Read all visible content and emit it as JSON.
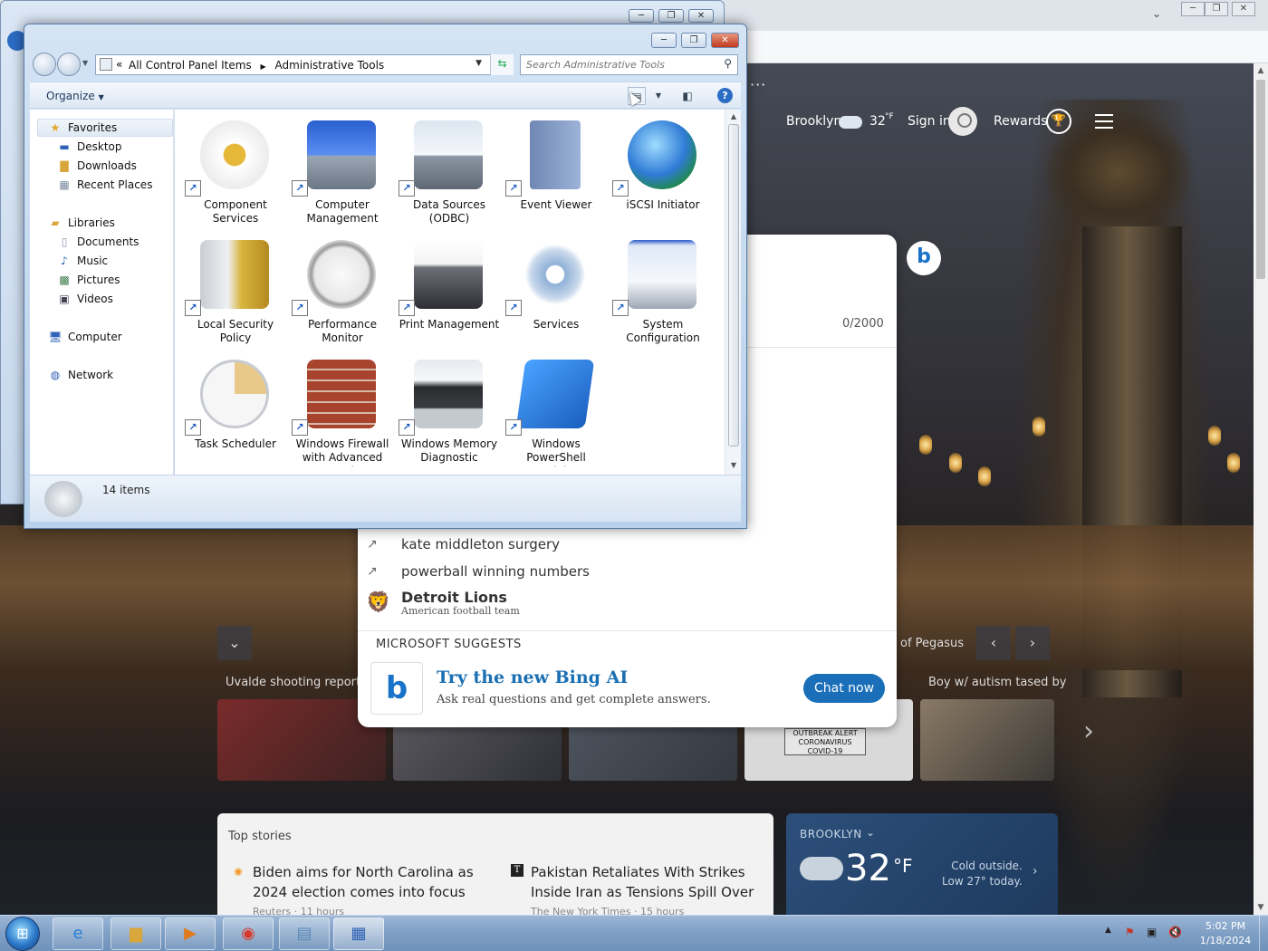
{
  "browser": {
    "window_controls": [
      "─",
      "❐",
      "✕"
    ],
    "toolbar_icons": [
      "share-icon",
      "star-icon",
      "sidebar-icon",
      "profile-icon",
      "menu-icon"
    ]
  },
  "msn": {
    "more_label": "···",
    "location": "Brooklyn",
    "temperature": "32",
    "temp_unit": "°F",
    "sign_in": "Sign in",
    "rewards": "Rewards",
    "char_counter": "0/2000",
    "suggestions": [
      {
        "icon": "trending-icon",
        "text": "kate middleton surgery"
      },
      {
        "icon": "trending-icon",
        "text": "powerball winning numbers"
      }
    ],
    "entity": {
      "title": "Detroit Lions",
      "subtitle": "American football team"
    },
    "microsoft_suggests": "MICROSOFT SUGGESTS",
    "bing_promo": {
      "title": "Try the new Bing AI",
      "subtitle": "Ask real questions and get complete answers.",
      "button": "Chat now"
    },
    "carousel": {
      "left_label": "Uvalde shooting report",
      "right_label": "Boy w/ autism tased by",
      "peg_label": "of Pegasus",
      "covid_badge": "OUTBREAK ALERT CORONAVIRUS COVID-19"
    },
    "top_stories": {
      "title": "Top stories",
      "items": [
        {
          "headline": "Biden aims for North Carolina as 2024 election comes into focus",
          "source": "Reuters · 11 hours"
        },
        {
          "headline": "Pakistan Retaliates With Strikes Inside Iran as Tensions Spill Over",
          "source": "The New York Times · 15 hours"
        }
      ]
    },
    "weather_card": {
      "city": "BROOKLYN",
      "temp": "32",
      "unit": "°F",
      "note_line1": "Cold outside.",
      "note_line2": "Low 27° today."
    }
  },
  "explorer": {
    "window_controls": [
      "─",
      "❐",
      "✕"
    ],
    "address": {
      "prefix": "«",
      "crumbs": [
        "All Control Panel Items",
        "Administrative Tools"
      ]
    },
    "search_placeholder": "Search Administrative Tools",
    "organize": "Organize",
    "nav": {
      "favorites": "Favorites",
      "fav_items": [
        "Desktop",
        "Downloads",
        "Recent Places"
      ],
      "libraries": "Libraries",
      "lib_items": [
        "Documents",
        "Music",
        "Pictures",
        "Videos"
      ],
      "computer": "Computer",
      "network": "Network"
    },
    "items": [
      {
        "label": "Component Services",
        "icon": "component-services-icon"
      },
      {
        "label": "Computer Management",
        "icon": "computer-management-icon"
      },
      {
        "label": "Data Sources (ODBC)",
        "icon": "data-sources-icon"
      },
      {
        "label": "Event Viewer",
        "icon": "event-viewer-icon"
      },
      {
        "label": "iSCSI Initiator",
        "icon": "iscsi-initiator-icon"
      },
      {
        "label": "Local Security Policy",
        "icon": "local-security-policy-icon"
      },
      {
        "label": "Performance Monitor",
        "icon": "performance-monitor-icon"
      },
      {
        "label": "Print Management",
        "icon": "print-management-icon"
      },
      {
        "label": "Services",
        "icon": "services-icon"
      },
      {
        "label": "System Configuration",
        "icon": "system-configuration-icon"
      },
      {
        "label": "Task Scheduler",
        "icon": "task-scheduler-icon"
      },
      {
        "label": "Windows Firewall with Advanced Security",
        "icon": "firewall-icon"
      },
      {
        "label": "Windows Memory Diagnostic",
        "icon": "memory-diagnostic-icon"
      },
      {
        "label": "Windows PowerShell Modules",
        "icon": "powershell-icon"
      }
    ],
    "status": "14 items"
  },
  "taskbar": {
    "clock_time": "5:02 PM",
    "clock_date": "1/18/2024",
    "apps": [
      "internet-explorer-icon",
      "file-explorer-icon",
      "media-player-icon",
      "chrome-icon",
      "notepad-icon",
      "control-panel-icon"
    ]
  }
}
